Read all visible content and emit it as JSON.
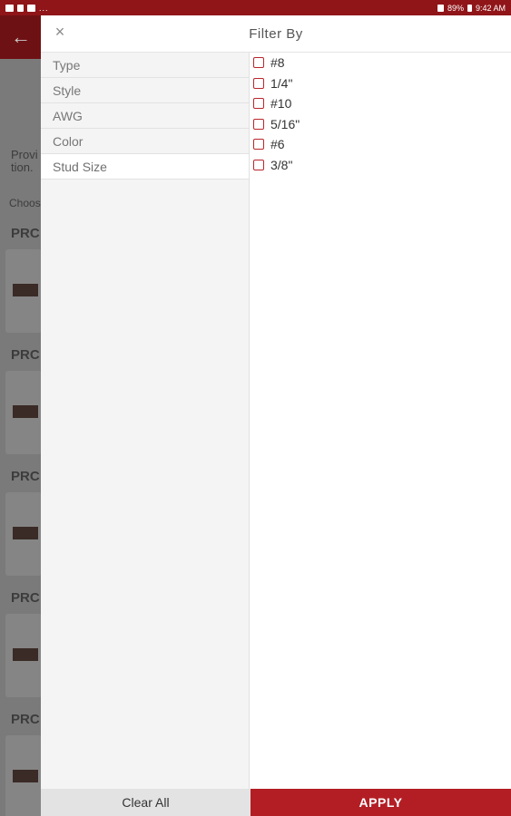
{
  "status_bar": {
    "left_icons": [
      "gallery-icon",
      "signal-icon",
      "app-icon"
    ],
    "overflow": "...",
    "battery": "89%",
    "time": "9:42 AM",
    "color": "#8f1519"
  },
  "background": {
    "back_arrow": "←",
    "text_fragment_1": "Provi",
    "text_fragment_2": "tion.",
    "choose_fragment": "Choos",
    "product_fragment": "PRC"
  },
  "filter": {
    "title": "Filter By",
    "close": "×",
    "categories": [
      {
        "label": "Type"
      },
      {
        "label": "Style"
      },
      {
        "label": "AWG"
      },
      {
        "label": "Color"
      },
      {
        "label": "Stud Size",
        "active": true
      }
    ],
    "options": [
      {
        "label": "#8",
        "checked": false
      },
      {
        "label": "1/4\"",
        "checked": false
      },
      {
        "label": "#10",
        "checked": false
      },
      {
        "label": "5/16\"",
        "checked": false
      },
      {
        "label": "#6",
        "checked": false
      },
      {
        "label": "3/8\"",
        "checked": false
      }
    ],
    "clear_label": "Clear All",
    "apply_label": "APPLY",
    "accent_color": "#b31e24"
  }
}
